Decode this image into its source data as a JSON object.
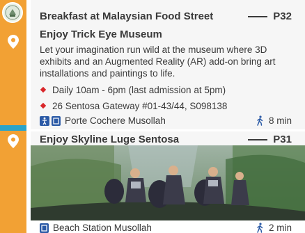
{
  "colors": {
    "rail": "#f2a134",
    "card": "#f6f6f6",
    "accent_red": "#d9262a",
    "icon_blue": "#2b5aa6",
    "teal": "#2aa3c8"
  },
  "stops": [
    {
      "title": "Breakfast at Malaysian Food Street",
      "page": "P32"
    },
    {
      "title": "Enjoy Trick Eye Museum",
      "description": "Let your imagination run wild at the museum where 3D exhibits and an Augmented Reality (AR) add-on bring art installations and paintings to life.",
      "details": [
        "Daily 10am - 6pm (last admission at 5pm)",
        "26 Sentosa Gateway #01-43/44, S098138"
      ],
      "facility": "Porte Cochere Musollah",
      "walk": "8 min"
    },
    {
      "title": "Enjoy Skyline Luge Sentosa",
      "page": "P31",
      "facility": "Beach Station Musollah",
      "walk": "2 min"
    }
  ],
  "icons": [
    "location-pin-icon",
    "diamond-bullet-icon",
    "accessibility-icon",
    "musollah-icon",
    "walking-person-icon"
  ]
}
